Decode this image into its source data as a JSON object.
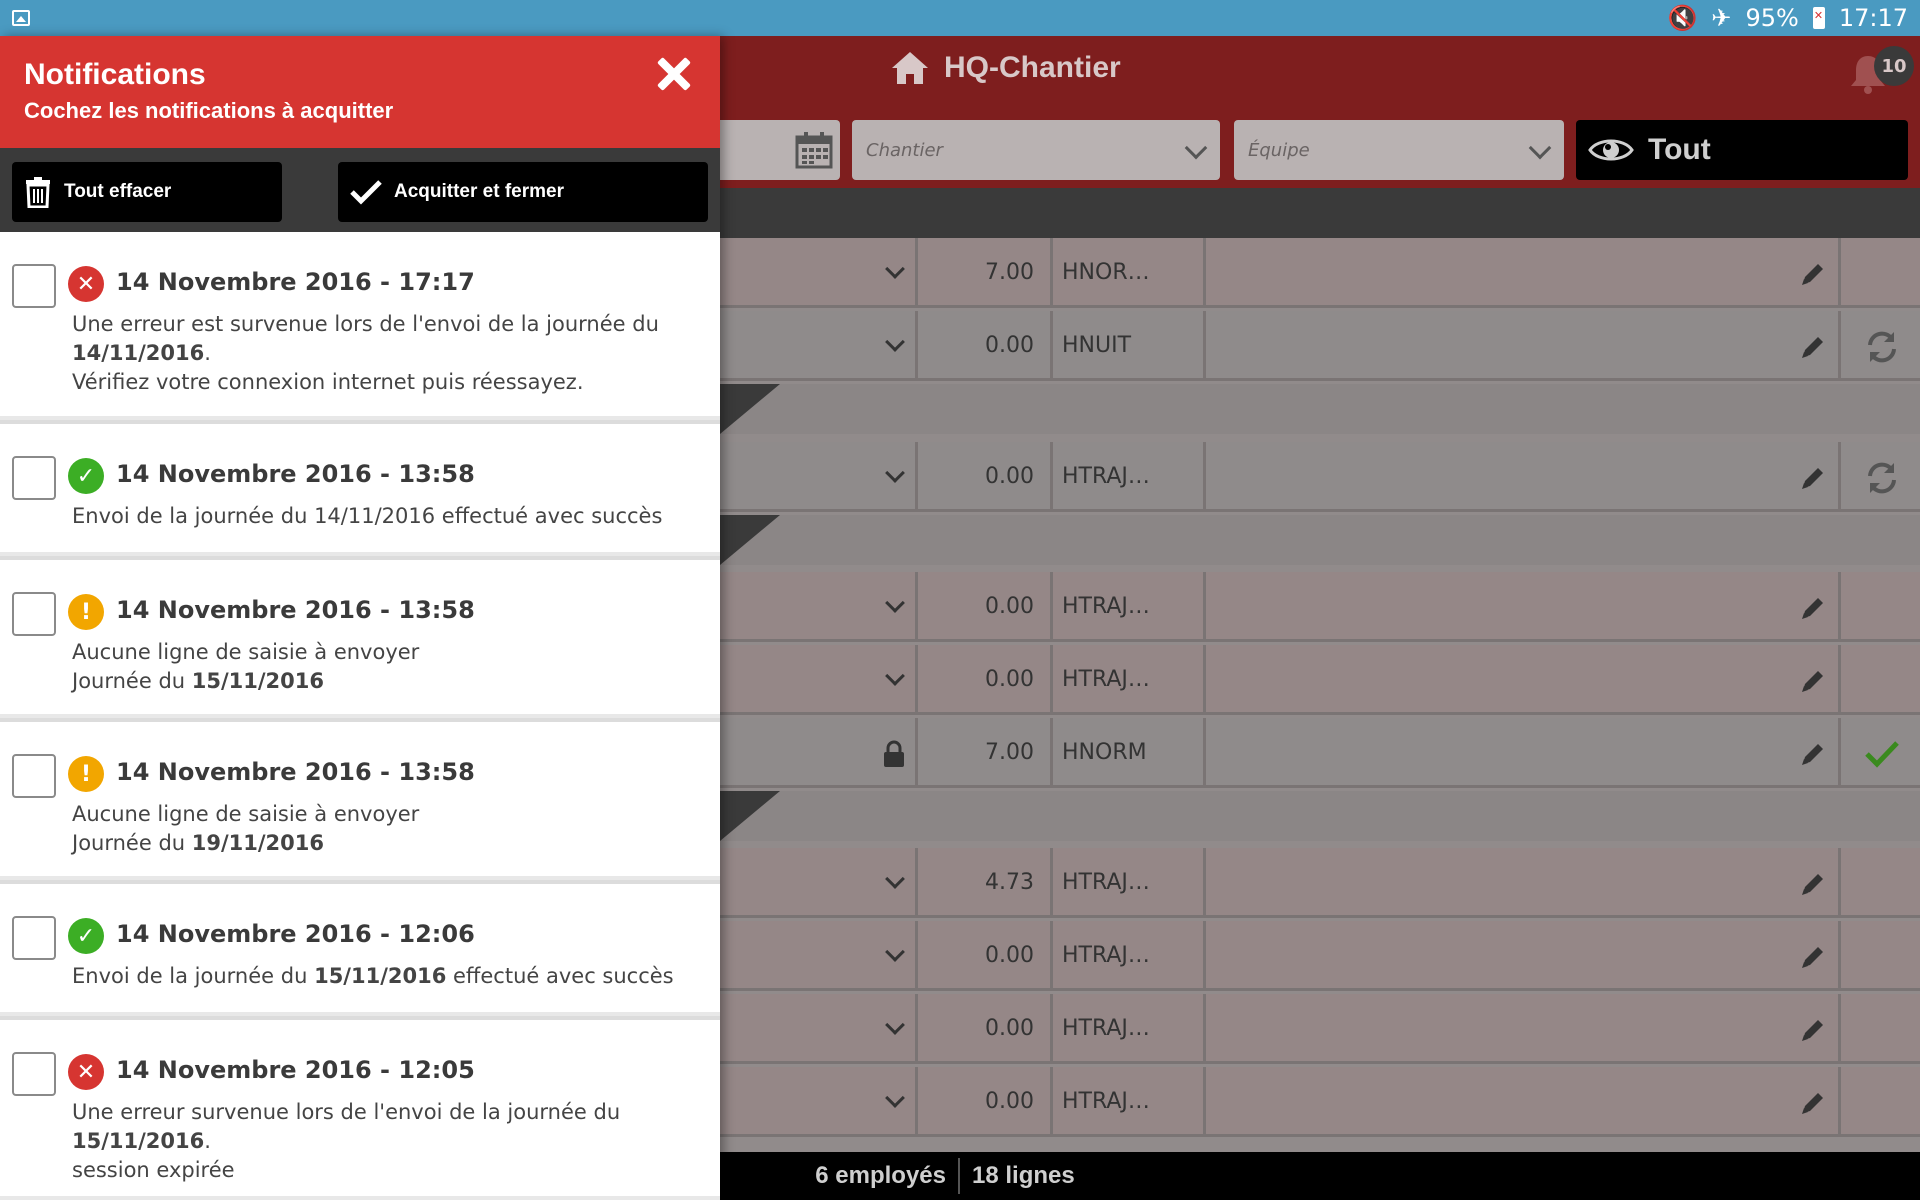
{
  "status_bar": {
    "battery": "95%",
    "time": "17:17"
  },
  "app": {
    "title": "HQ-Chantier",
    "notification_count": "10"
  },
  "filters": {
    "chantier_placeholder": "Chantier",
    "equipe_placeholder": "Équipe",
    "view_button": "Tout"
  },
  "rows": [
    {
      "hours": "7.00",
      "code": "HNOR…",
      "sync": "",
      "locked": false
    },
    {
      "hours": "0.00",
      "code": "HNUIT",
      "sync": "refresh",
      "locked": false
    },
    {
      "hours": "0.00",
      "code": "HTRAJ…",
      "sync": "refresh",
      "locked": false
    },
    {
      "hours": "0.00",
      "code": "HTRAJ…",
      "sync": "",
      "locked": false
    },
    {
      "hours": "0.00",
      "code": "HTRAJ…",
      "sync": "",
      "locked": false
    },
    {
      "hours": "7.00",
      "code": "HNORM",
      "sync": "check",
      "locked": true
    },
    {
      "hours": "4.73",
      "code": "HTRAJ…",
      "sync": "",
      "locked": false
    },
    {
      "hours": "0.00",
      "code": "HTRAJ…",
      "sync": "",
      "locked": false
    },
    {
      "hours": "0.00",
      "code": "HTRAJ…",
      "sync": "",
      "locked": false
    },
    {
      "hours": "0.00",
      "code": "HTRAJ…",
      "sync": "",
      "locked": false
    }
  ],
  "footer": {
    "employees": "6 employés",
    "lines": "18 lignes"
  },
  "panel": {
    "title": "Notifications",
    "subtitle": "Cochez les notifications à acquitter",
    "clear_all": "Tout effacer",
    "acknowledge_close": "Acquitter et fermer",
    "notifications": [
      {
        "status": "error",
        "title": "14 Novembre 2016 - 17:17",
        "lines": [
          [
            {
              "t": "Une erreur est survenue lors de l'envoi de la journée du"
            }
          ],
          [
            {
              "t": "14/11/2016",
              "b": true
            },
            {
              "t": "."
            }
          ],
          [
            {
              "t": "Vérifiez votre connexion internet puis réessayez."
            }
          ]
        ]
      },
      {
        "status": "ok",
        "title": "14 Novembre 2016 - 13:58",
        "lines": [
          [
            {
              "t": "Envoi de la journée du 14/11/2016 effectué avec succès"
            }
          ]
        ]
      },
      {
        "status": "warn",
        "title": "14 Novembre 2016 - 13:58",
        "lines": [
          [
            {
              "t": "Aucune ligne de saisie à envoyer"
            }
          ],
          [
            {
              "t": "Journée du "
            },
            {
              "t": "15/11/2016",
              "b": true
            }
          ]
        ]
      },
      {
        "status": "warn",
        "title": "14 Novembre 2016 - 13:58",
        "lines": [
          [
            {
              "t": "Aucune ligne de saisie à envoyer"
            }
          ],
          [
            {
              "t": "Journée du "
            },
            {
              "t": "19/11/2016",
              "b": true
            }
          ]
        ]
      },
      {
        "status": "ok",
        "title": "14 Novembre 2016 - 12:06",
        "lines": [
          [
            {
              "t": "Envoi de la journée du "
            },
            {
              "t": "15/11/2016",
              "b": true
            },
            {
              "t": " effectué avec succès"
            }
          ]
        ]
      },
      {
        "status": "error",
        "title": "14 Novembre 2016 - 12:05",
        "lines": [
          [
            {
              "t": "Une erreur survenue lors de l'envoi de la journée du"
            }
          ],
          [
            {
              "t": "15/11/2016",
              "b": true
            },
            {
              "t": "."
            }
          ],
          [
            {
              "t": "session expirée"
            }
          ]
        ]
      }
    ]
  },
  "colors": {
    "accent_red": "#d63531",
    "header_dark_red": "#7e1e1e",
    "success_green": "#3cae25",
    "warning_orange": "#f2a600"
  }
}
